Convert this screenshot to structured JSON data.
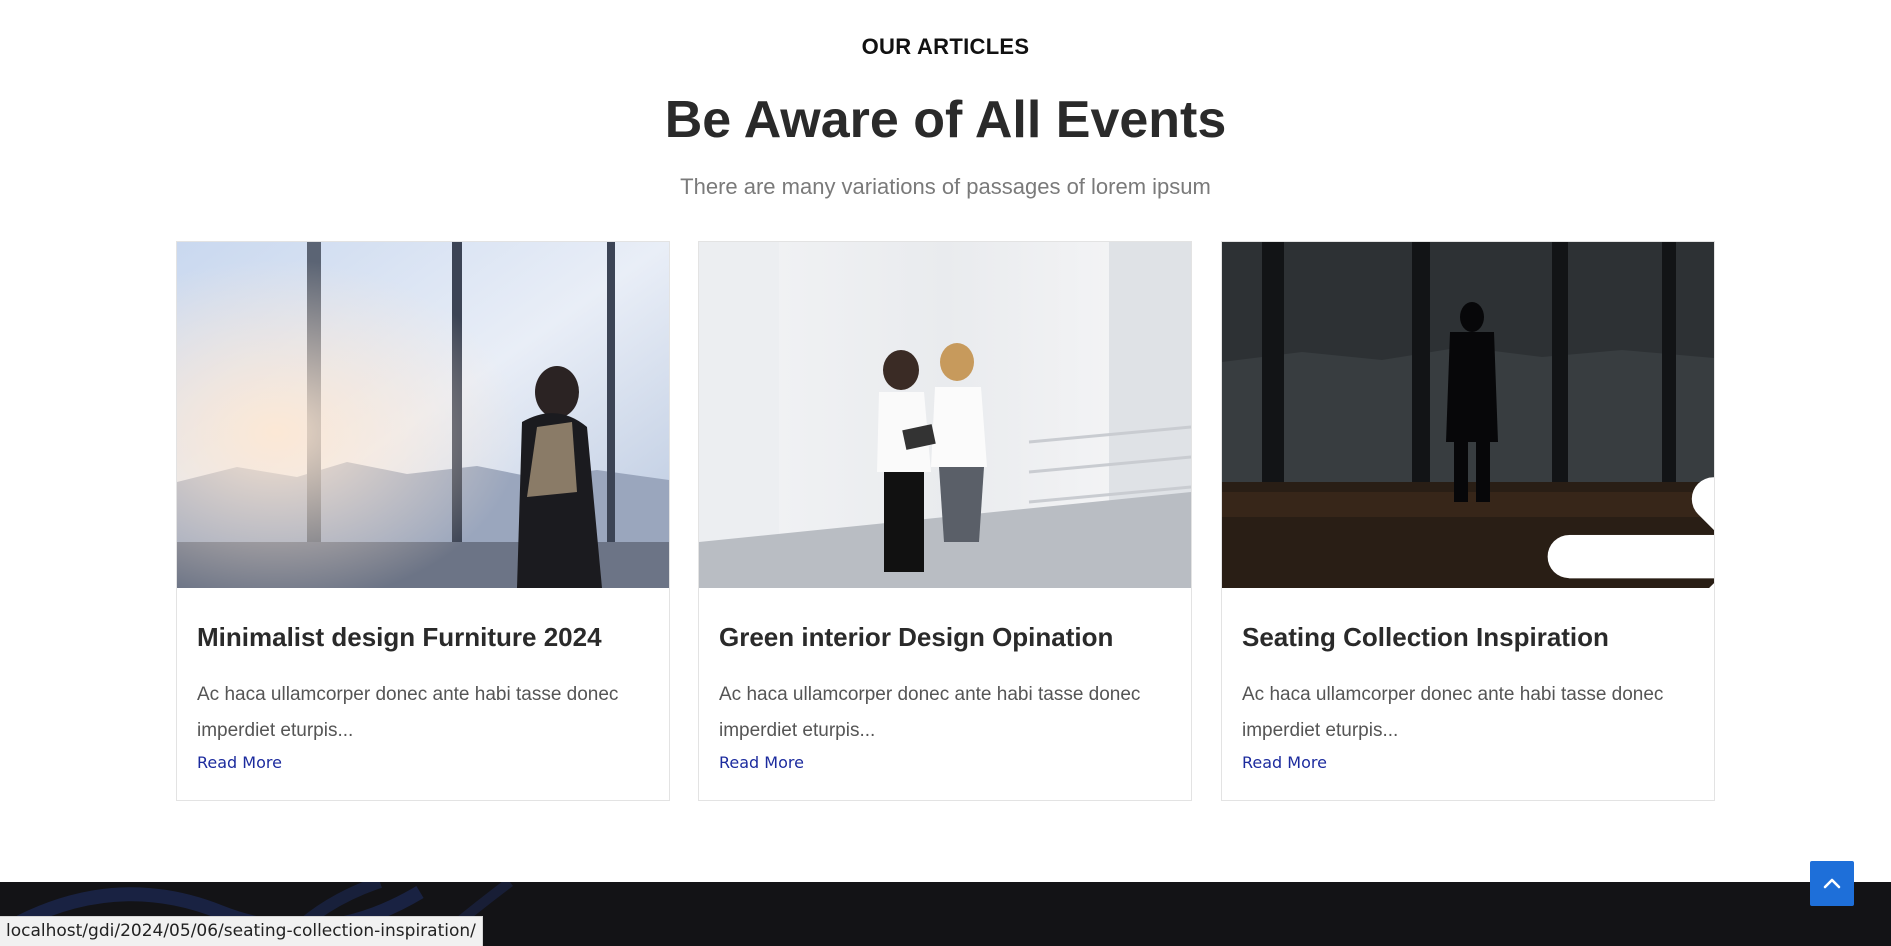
{
  "section": {
    "eyebrow": "OUR ARTICLES",
    "title": "Be Aware of All Events",
    "subtitle": "There are many variations of passages of lorem ipsum"
  },
  "articles": [
    {
      "title": "Minimalist design Furniture 2024",
      "excerpt": "Ac haca ullamcorper donec ante habi tasse donec imperdiet eturpis...",
      "read_more": "Read More",
      "image_icon": "woman-at-window-photo"
    },
    {
      "title": "Green interior Design Opination",
      "excerpt": "Ac haca ullamcorper donec ante habi tasse donec imperdiet eturpis...",
      "read_more": "Read More",
      "image_icon": "two-women-walking-photo"
    },
    {
      "title": "Seating Collection Inspiration",
      "excerpt": "Ac haca ullamcorper donec ante habi tasse donec imperdiet eturpis...",
      "read_more": "Read More",
      "image_icon": "man-silhouette-office-photo",
      "hover_icon": "arrow-right-icon"
    }
  ],
  "status_bar": {
    "url": "localhost/gdi/2024/05/06/seating-collection-inspiration/"
  },
  "scroll_top": {
    "icon": "chevron-up-icon"
  },
  "colors": {
    "accent": "#1e6fd9",
    "link": "#1c2b9e",
    "footer": "#131316"
  }
}
